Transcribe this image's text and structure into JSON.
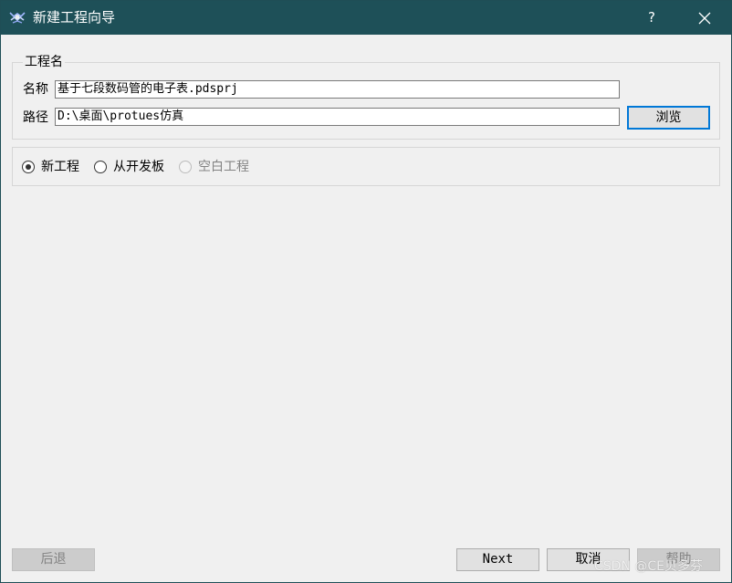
{
  "window": {
    "title": "新建工程向导",
    "help_label": "?",
    "close_icon": "close-icon",
    "titlebar_color": "#1e5058"
  },
  "project_group": {
    "title": "工程名",
    "name_label": "名称",
    "name_value": "基于七段数码管的电子表.pdsprj",
    "path_label": "路径",
    "path_value": "D:\\桌面\\protues仿真",
    "browse_label": "浏览",
    "accent_color": "#0078d7"
  },
  "project_type": {
    "options": [
      {
        "label": "新工程",
        "checked": true,
        "enabled": true
      },
      {
        "label": "从开发板",
        "checked": false,
        "enabled": true
      },
      {
        "label": "空白工程",
        "checked": false,
        "enabled": false
      }
    ]
  },
  "footer": {
    "back_label": "后退",
    "next_label": "Next",
    "cancel_label": "取消",
    "help_label": "帮助"
  },
  "watermark": {
    "text": "CSDN @CE贝多芬"
  }
}
